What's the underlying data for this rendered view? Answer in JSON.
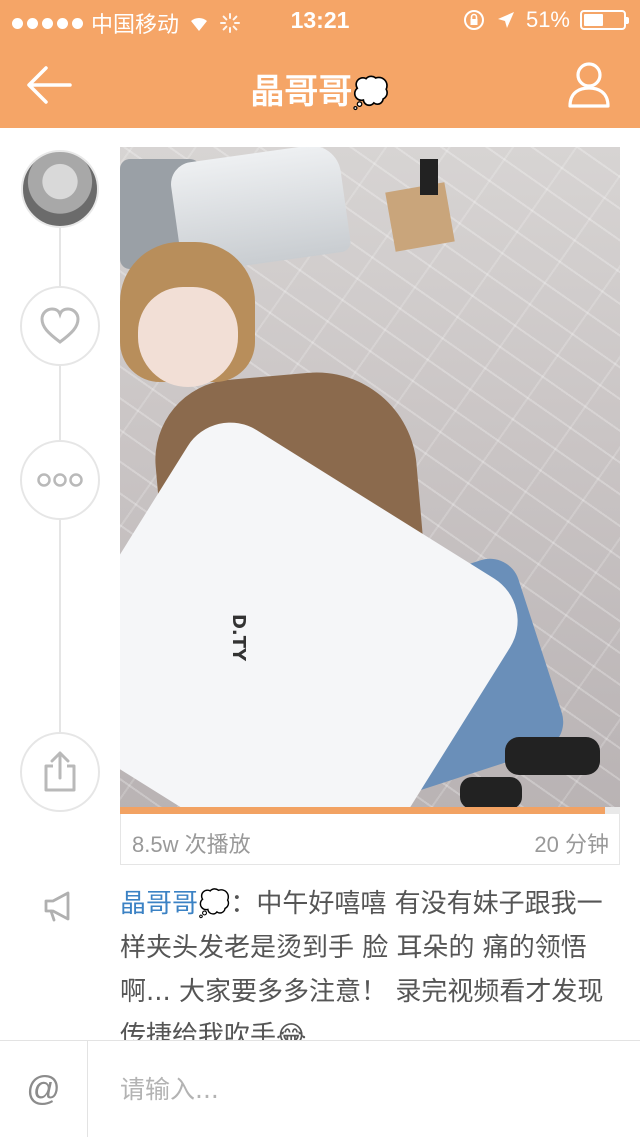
{
  "status_bar": {
    "carrier": "中国移动",
    "time": "13:21",
    "battery_percent": "51%",
    "battery_level": 0.51
  },
  "nav": {
    "title": "晶哥哥",
    "title_emoji": "💭",
    "back_icon": "arrow-left-icon",
    "profile_icon": "user-icon"
  },
  "side_actions": {
    "like_icon": "heart-icon",
    "more_icon": "ellipsis-icon",
    "share_icon": "share-icon"
  },
  "video": {
    "jacket_text": "D.TY",
    "progress": 0.97
  },
  "stats": {
    "play_count": "8.5w 次播放",
    "duration": "20 分钟"
  },
  "post": {
    "author": "晶哥哥💭",
    "separator": "：",
    "text": "中午好嘻嘻 有没有妹子跟我一样夹头发老是烫到手 脸 耳朵的 痛的领悟啊... 大家要多多注意！ 录完视频看才发现传捷给我吹手😂"
  },
  "comment": {
    "at_label": "@",
    "placeholder": "请输入..."
  },
  "colors": {
    "header": "#f5a567",
    "author_link": "#3b82c4",
    "progress": "#f2a263"
  }
}
